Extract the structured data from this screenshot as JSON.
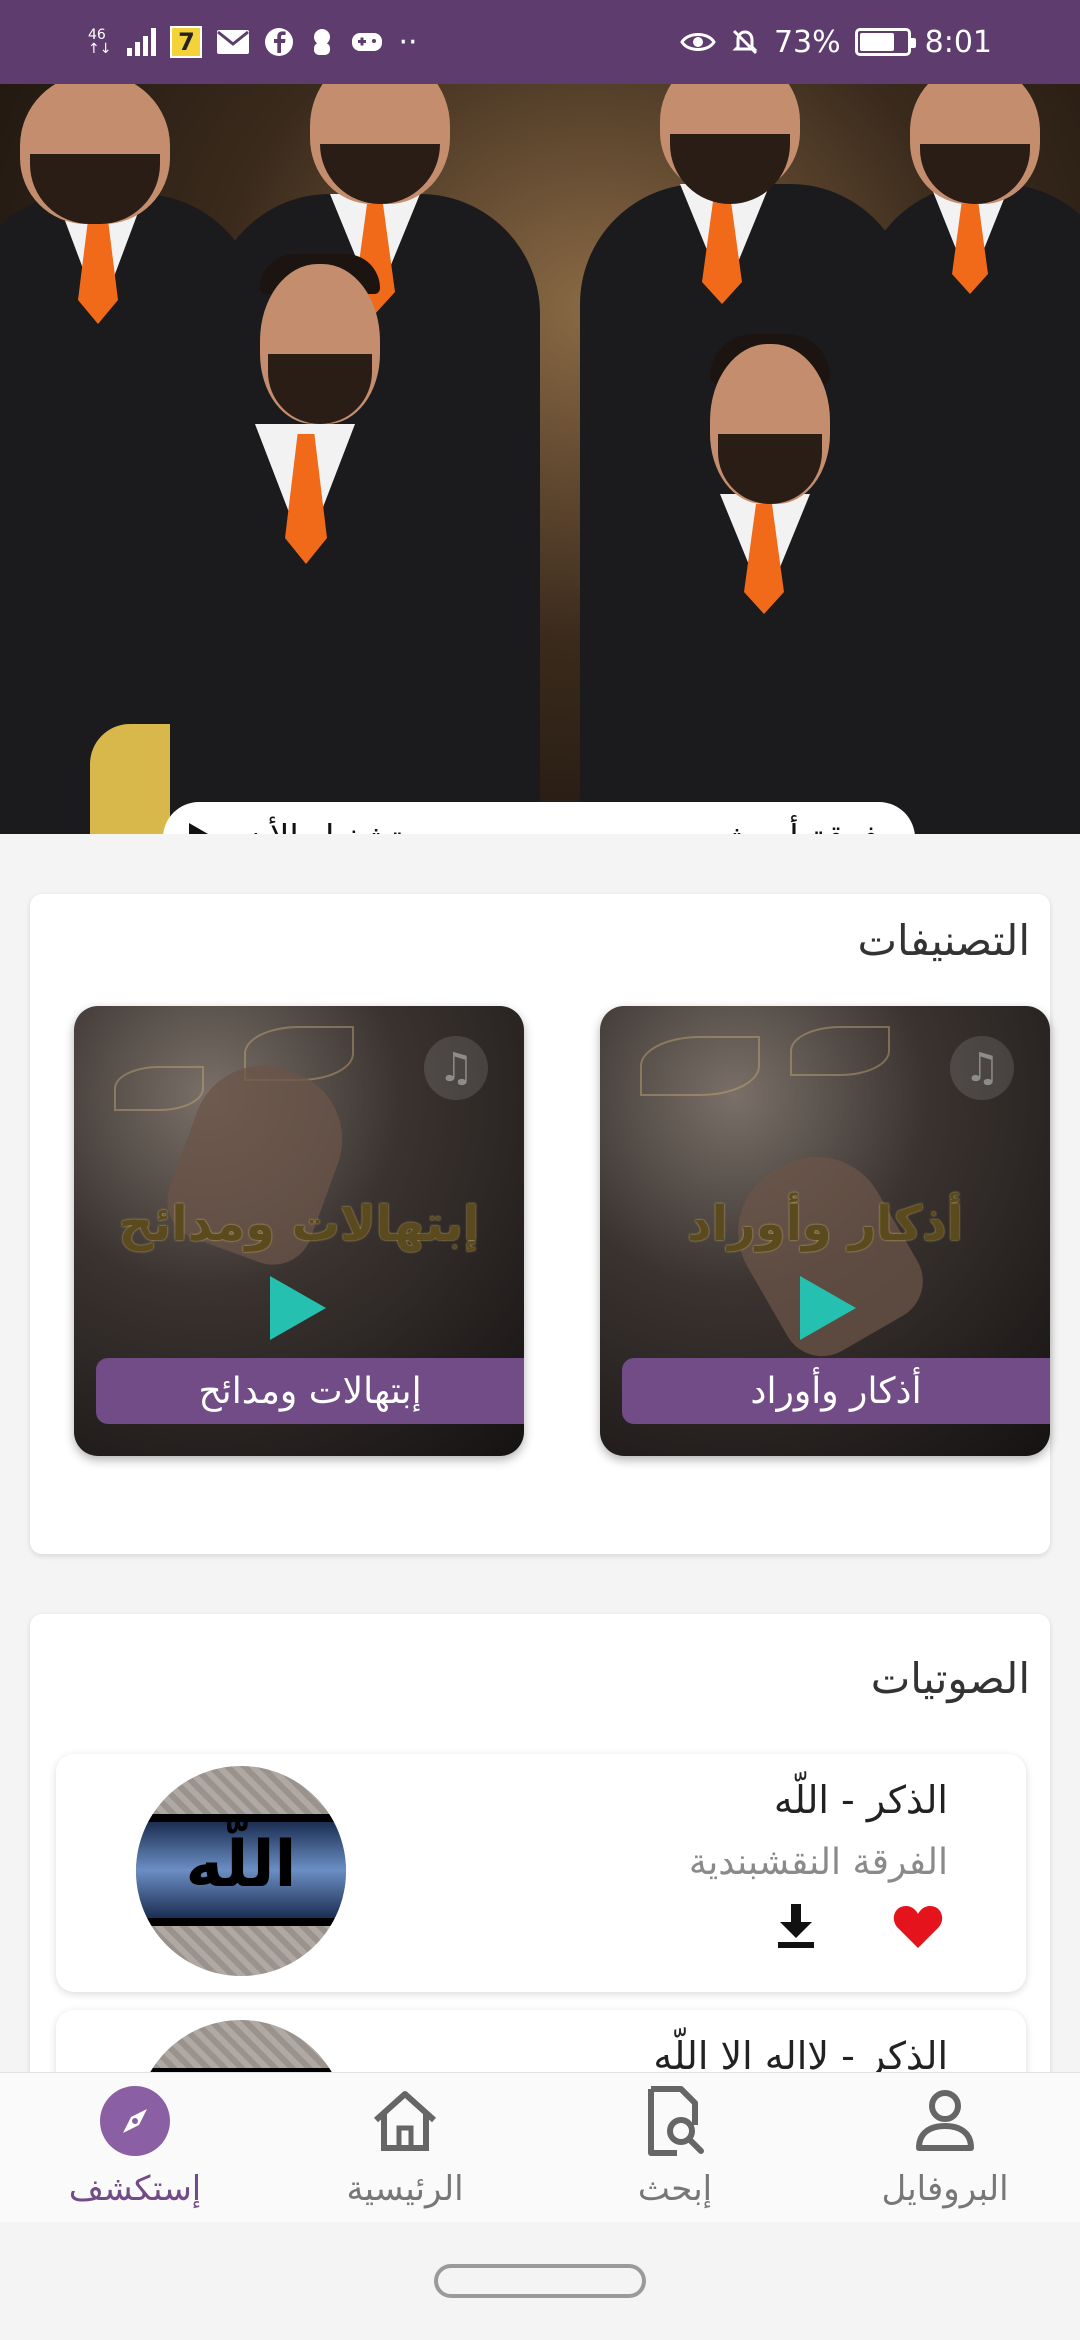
{
  "status_bar": {
    "net_top": "46",
    "net_bottom": "↑↓",
    "carrier_badge": "7",
    "battery_percent": "73%",
    "battery_level": 0.73,
    "time": "8:01",
    "more": "··"
  },
  "hero": {
    "artist": "فرقة أبو شعر",
    "play_label": "تشغيل الأن"
  },
  "categories": {
    "title": "التصنيفات",
    "items": [
      {
        "label": "أذكار وأوراد",
        "art_text": "أذكار وأوراد"
      },
      {
        "label": "إبتهالات ومدائح",
        "art_text": "إبتهالات ومدائح"
      }
    ],
    "art_icon": "music-note-icon"
  },
  "audios": {
    "title": "الصوتيات",
    "items": [
      {
        "title": "الذكر - اللّه",
        "artist": "الفرقة النقشبندية",
        "thumb_text": "اللّه",
        "favorite": true
      },
      {
        "title": "الذكر - لااله الا اللّه",
        "artist": "",
        "thumb_text": "",
        "favorite": false
      }
    ]
  },
  "bottom_nav": {
    "items": [
      {
        "label": "إستكشف",
        "icon": "compass-icon",
        "active": true
      },
      {
        "label": "الرئيسية",
        "icon": "home-icon",
        "active": false
      },
      {
        "label": "إبحث",
        "icon": "search-document-icon",
        "active": false
      },
      {
        "label": "البروفايل",
        "icon": "profile-icon",
        "active": false
      }
    ]
  },
  "colors": {
    "status_bar": "#5e3c6e",
    "accent": "#714c86",
    "favorite": "#e5141c",
    "play_teal": "#25c0b0"
  }
}
